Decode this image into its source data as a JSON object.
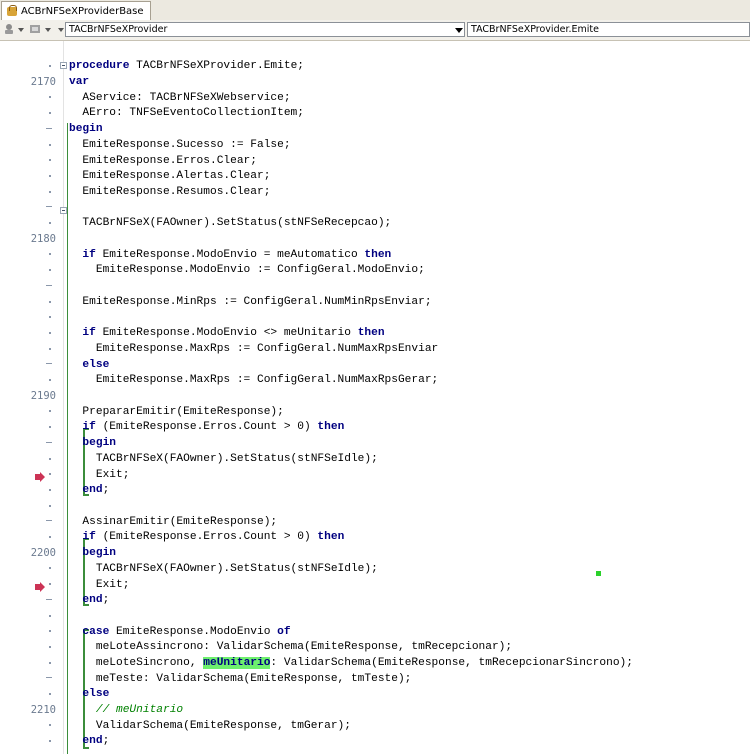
{
  "tab": {
    "label": "ACBrNFSeXProviderBase"
  },
  "toolbar": {
    "class_combo": "TACBrNFSeXProvider",
    "method_combo": "TACBrNFSeXProvider.Emite"
  },
  "gutter_numbers": {
    "n2170": "2170",
    "n2180": "2180",
    "n2190": "2190",
    "n2200": "2200",
    "n2210": "2210"
  },
  "code": {
    "l01_kw": "procedure",
    "l01_txt": " TACBrNFSeXProvider.Emite;",
    "l02_kw": "var",
    "l03": "  AService: TACBrNFSeXWebservice;",
    "l04": "  AErro: TNFSeEventoCollectionItem;",
    "l05_kw": "begin",
    "l06": "  EmiteResponse.Sucesso := False;",
    "l07": "  EmiteResponse.Erros.Clear;",
    "l08": "  EmiteResponse.Alertas.Clear;",
    "l09": "  EmiteResponse.Resumos.Clear;",
    "l11": "  TACBrNFSeX(FAOwner).SetStatus(stNFSeRecepcao);",
    "l13_kw1": "  if",
    "l13_txt": " EmiteResponse.ModoEnvio = meAutomatico ",
    "l13_kw2": "then",
    "l14": "    EmiteResponse.ModoEnvio := ConfigGeral.ModoEnvio;",
    "l16": "  EmiteResponse.MinRps := ConfigGeral.NumMinRpsEnviar;",
    "l18_kw1": "  if",
    "l18_txt": " EmiteResponse.ModoEnvio <> meUnitario ",
    "l18_kw2": "then",
    "l19": "    EmiteResponse.MaxRps := ConfigGeral.NumMaxRpsEnviar",
    "l20_kw": "  else",
    "l21": "    EmiteResponse.MaxRps := ConfigGeral.NumMaxRpsGerar;",
    "l23": "  PrepararEmitir(EmiteResponse);",
    "l24_kw1": "  if",
    "l24_txt": " (EmiteResponse.Erros.Count > 0) ",
    "l24_kw2": "then",
    "l25_kw": "  begin",
    "l26": "    TACBrNFSeX(FAOwner).SetStatus(stNFSeIdle);",
    "l27": "    Exit;",
    "l28_kw": "  end",
    "l28_txt": ";",
    "l30": "  AssinarEmitir(EmiteResponse);",
    "l31_kw1": "  if",
    "l31_txt": " (EmiteResponse.Erros.Count > 0) ",
    "l31_kw2": "then",
    "l32_kw": "  begin",
    "l33": "    TACBrNFSeX(FAOwner).SetStatus(stNFSeIdle);",
    "l34": "    Exit;",
    "l35_kw": "  end",
    "l35_txt": ";",
    "l37_kw1": "  case",
    "l37_txt": " EmiteResponse.ModoEnvio ",
    "l37_kw2": "of",
    "l38": "    meLoteAssincrono: ValidarSchema(EmiteResponse, tmRecepcionar);",
    "l39_a": "    meLoteSincrono, ",
    "l39_hl": "meUnitario",
    "l39_b": ": ValidarSchema(EmiteResponse, tmRecepcionarSincrono);",
    "l40": "    meTeste: ValidarSchema(EmiteResponse, tmTeste);",
    "l41_kw": "  else",
    "l42_cm": "    // meUnitario",
    "l43": "    ValidarSchema(EmiteResponse, tmGerar);",
    "l44_kw": "  end",
    "l44_txt": ";"
  },
  "colors": {
    "keyword": "#000080",
    "comment": "#008000",
    "highlight": "#6ef06e",
    "bracket": "#3b8d3b",
    "exit_marker": "#cc3355"
  }
}
